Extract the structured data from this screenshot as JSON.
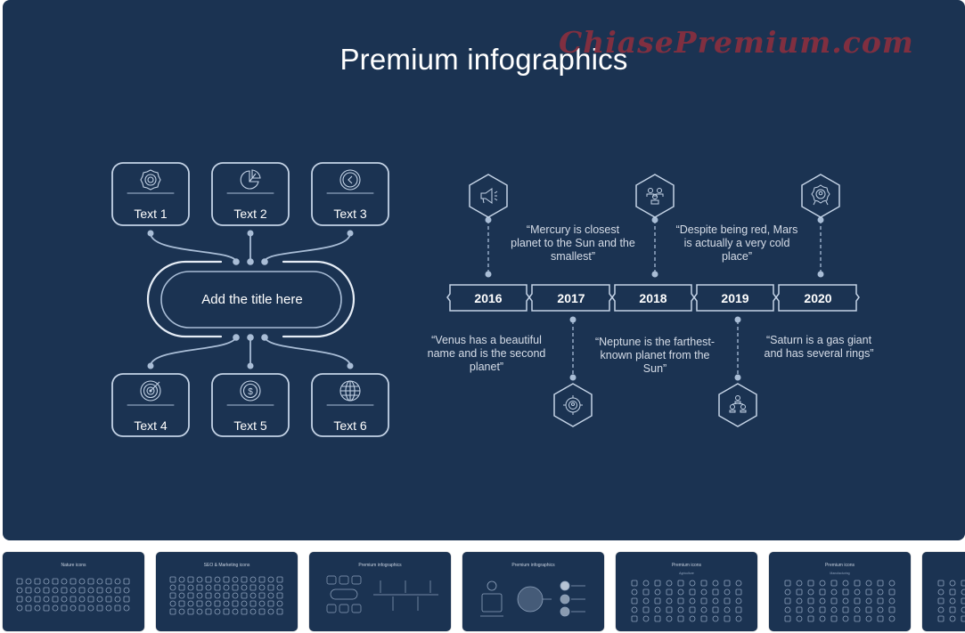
{
  "slide": {
    "title": "Premium infographics",
    "watermark": "ChiasePremium.com",
    "colors": {
      "background": "#1b3352",
      "line": "#a9bdd6",
      "text": "#ffffff",
      "watermark": "#8c2f3f"
    },
    "hub": {
      "title": "Add the title here",
      "top_items": [
        {
          "label": "Text 1",
          "icon": "gear-icon"
        },
        {
          "label": "Text 2",
          "icon": "pie-chart-icon"
        },
        {
          "label": "Text 3",
          "icon": "back-arrow-circle-icon"
        }
      ],
      "bottom_items": [
        {
          "label": "Text 4",
          "icon": "target-icon"
        },
        {
          "label": "Text 5",
          "icon": "dollar-coin-icon"
        },
        {
          "label": "Text 6",
          "icon": "globe-icon"
        }
      ]
    },
    "timeline": {
      "years": [
        "2016",
        "2017",
        "2018",
        "2019",
        "2020"
      ],
      "events": [
        {
          "year": "2016",
          "icon": "megaphone-icon",
          "position": "top",
          "quote": "“Venus has a beautiful name and is the second planet”"
        },
        {
          "year": "2017",
          "icon": "target-user-icon",
          "position": "bottom",
          "quote": "“Mercury is closest planet to the Sun and the smallest”"
        },
        {
          "year": "2018",
          "icon": "team-icon",
          "position": "top",
          "quote": "“Neptune is the farthest-known planet from the Sun”"
        },
        {
          "year": "2019",
          "icon": "hierarchy-icon",
          "position": "bottom",
          "quote": "“Despite being red, Mars is actually a very cold place”"
        },
        {
          "year": "2020",
          "icon": "award-icon",
          "position": "top",
          "quote": "“Saturn is a gas giant and has several rings”"
        }
      ]
    }
  },
  "thumbnails": [
    {
      "title": "Nature icons",
      "subtitle": ""
    },
    {
      "title": "SEO & Marketing icons",
      "subtitle": ""
    },
    {
      "title": "Premium infographics",
      "subtitle": ""
    },
    {
      "title": "Premium infographics",
      "subtitle": ""
    },
    {
      "title": "Premium icons",
      "subtitle": "Agriculture"
    },
    {
      "title": "Premium icons",
      "subtitle": "Manufacturing"
    },
    {
      "title": "",
      "subtitle": ""
    }
  ]
}
